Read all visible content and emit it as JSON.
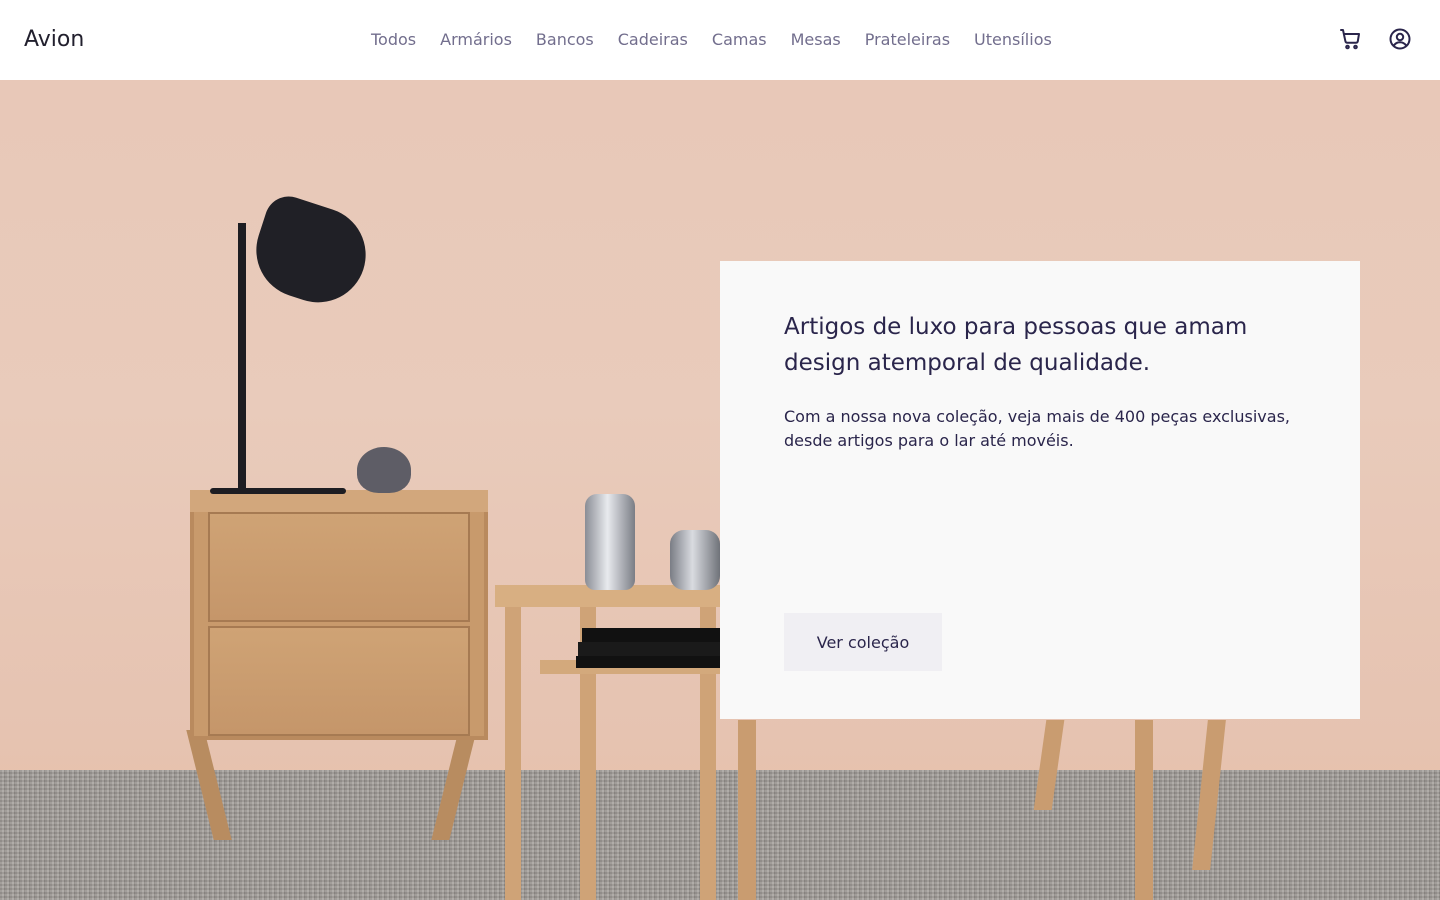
{
  "header": {
    "logo": "Avion",
    "nav": [
      "Todos",
      "Armários",
      "Bancos",
      "Cadeiras",
      "Camas",
      "Mesas",
      "Prateleiras",
      "Utensílios"
    ],
    "icons": [
      "cart-icon",
      "user-icon"
    ]
  },
  "hero": {
    "headline": "Artigos de luxo para pessoas que amam design atemporal de qualidade.",
    "description": "Com a nossa nova coleção, veja mais de 400 peças exclusivas, desde artigos para o lar até movéis.",
    "cta_label": "Ver coleção"
  },
  "colors": {
    "primary": "#2A254B",
    "card_bg": "#F9F9F9",
    "button_bg": "#F0EFF3",
    "wall": "#E8C8B8"
  }
}
